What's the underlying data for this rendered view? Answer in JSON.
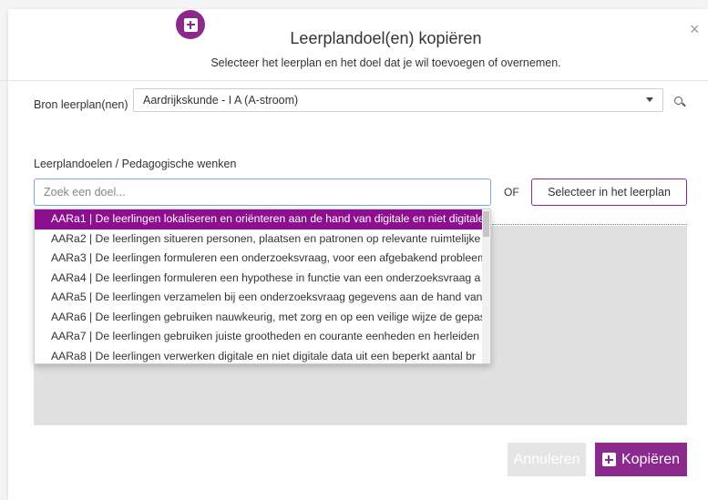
{
  "header": {
    "title": "Leerplandoel(en) kopiëren",
    "subtitle": "Selecteer het leerplan en het doel dat je wil toevoegen of overnemen.",
    "close": "×"
  },
  "bron": {
    "label": "Bron leerplan(nen)",
    "selected": "Aardrijkskunde - I A (A-stroom)"
  },
  "goals": {
    "label": "Leerplandoelen / Pedagogische wenken",
    "placeholder": "Zoek een doel...",
    "or": "OF",
    "select_button": "Selecteer in het leerplan"
  },
  "dropdown": {
    "options": [
      "AARa1 | De leerlingen lokaliseren en oriënteren aan de hand van digitale en niet digitale",
      "AARa2 | De leerlingen situeren personen, plaatsen en patronen op relevante ruimtelijke",
      "AARa3 | De leerlingen formuleren een onderzoeksvraag, voor een afgebakend probleem",
      "AARa4 | De leerlingen formuleren een hypothese in functie van een onderzoeksvraag a",
      "AARa5 | De leerlingen verzamelen bij een onderzoeksvraag gegevens aan de hand van",
      "AARa6 | De leerlingen gebruiken nauwkeurig, met zorg en op een veilige wijze de gepas",
      "AARa7 | De leerlingen gebruiken juiste grootheden en courante eenheden en herleiden",
      "AARa8 | De leerlingen verwerken digitale en niet digitale data uit een beperkt aantal br"
    ],
    "selected_index": 0
  },
  "footer": {
    "cancel": "Annuleren",
    "copy": "Kopiëren"
  },
  "colors": {
    "accent": "#8b2a8c",
    "selected_option": "#8b0f8f"
  }
}
